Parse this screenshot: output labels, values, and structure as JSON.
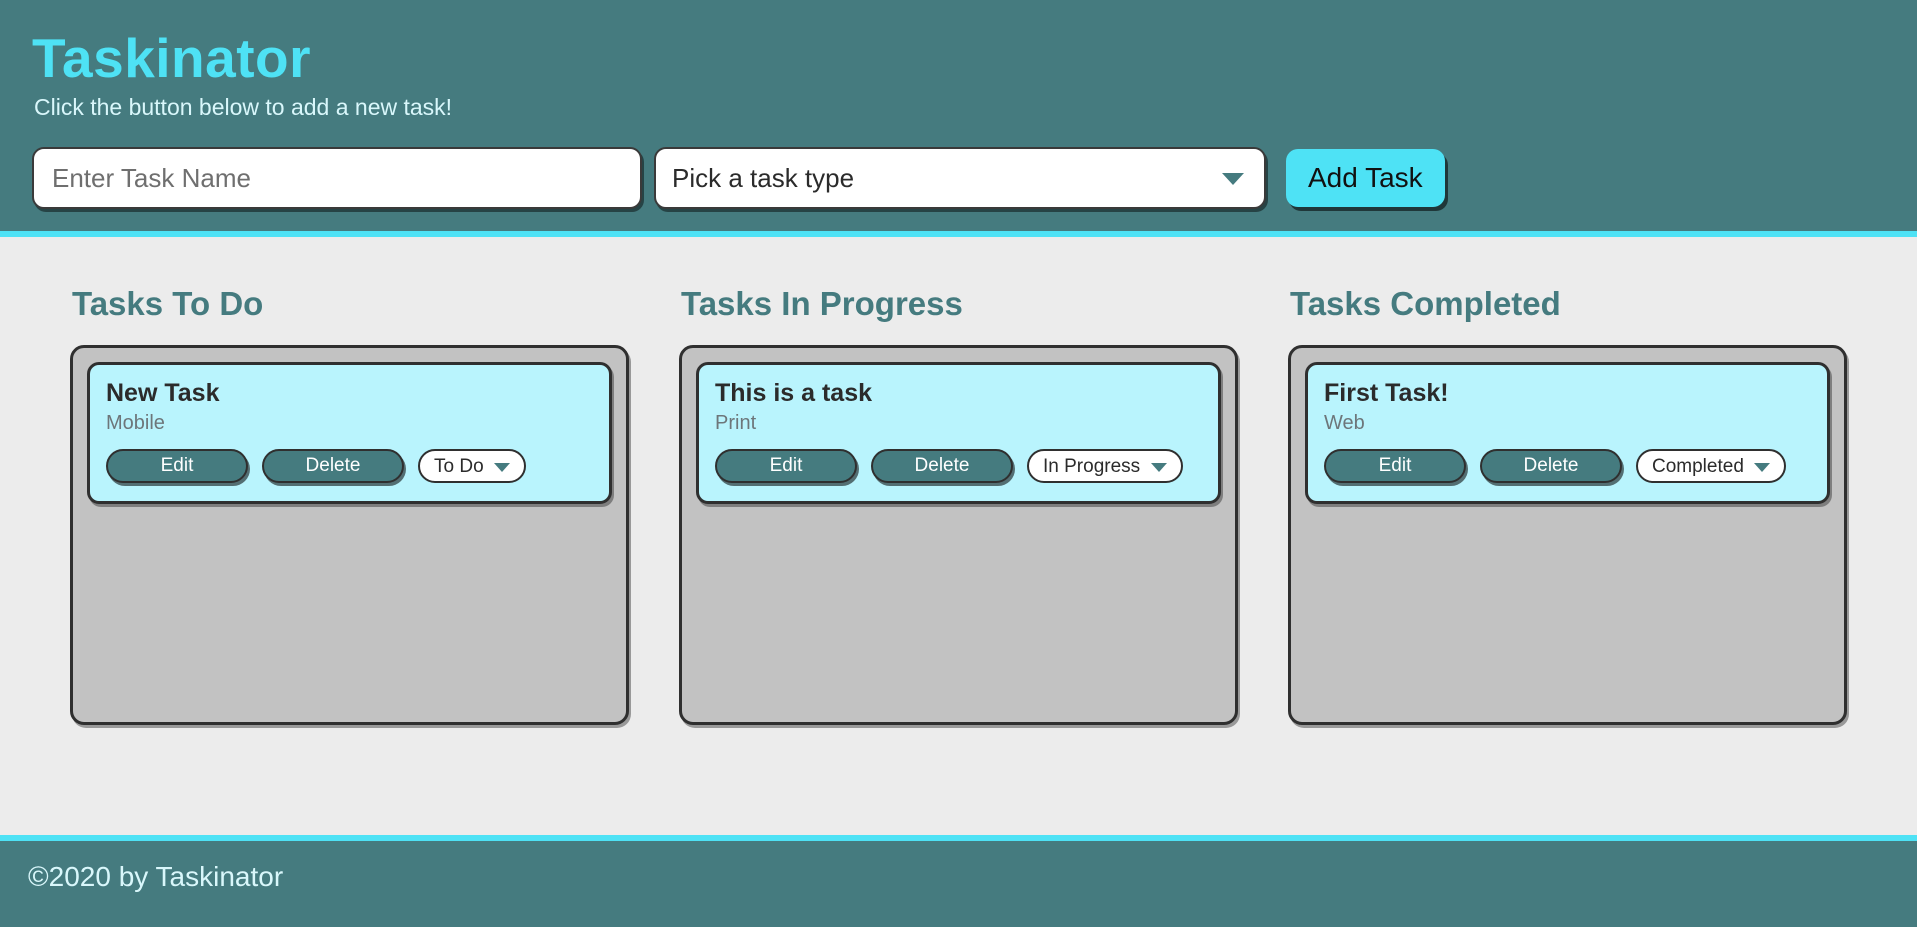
{
  "header": {
    "title": "Taskinator",
    "subtitle": "Click the button below to add a new task!",
    "form": {
      "task_name_placeholder": "Enter Task Name",
      "task_name_value": "",
      "task_type_selected": "Pick a task type",
      "task_type_options": [
        "Pick a task type",
        "Web",
        "Mobile",
        "Print"
      ],
      "add_button_label": "Add Task"
    },
    "accent_color": "#4ee2f5",
    "background_color": "#457b7f"
  },
  "main": {
    "columns": [
      {
        "title": "Tasks To Do",
        "tasks": [
          {
            "name": "New Task",
            "type": "Mobile",
            "edit_label": "Edit",
            "delete_label": "Delete",
            "status": "To Do",
            "status_options": [
              "To Do",
              "In Progress",
              "Completed"
            ]
          }
        ]
      },
      {
        "title": "Tasks In Progress",
        "tasks": [
          {
            "name": "This is a task",
            "type": "Print",
            "edit_label": "Edit",
            "delete_label": "Delete",
            "status": "In Progress",
            "status_options": [
              "To Do",
              "In Progress",
              "Completed"
            ]
          }
        ]
      },
      {
        "title": "Tasks Completed",
        "tasks": [
          {
            "name": "First Task!",
            "type": "Web",
            "edit_label": "Edit",
            "delete_label": "Delete",
            "status": "Completed",
            "status_options": [
              "To Do",
              "In Progress",
              "Completed"
            ]
          }
        ]
      }
    ],
    "background_color": "#ececec",
    "list_color": "#c2c2c2",
    "card_color": "#b9f4fd"
  },
  "footer": {
    "text": "©2020 by Taskinator"
  }
}
